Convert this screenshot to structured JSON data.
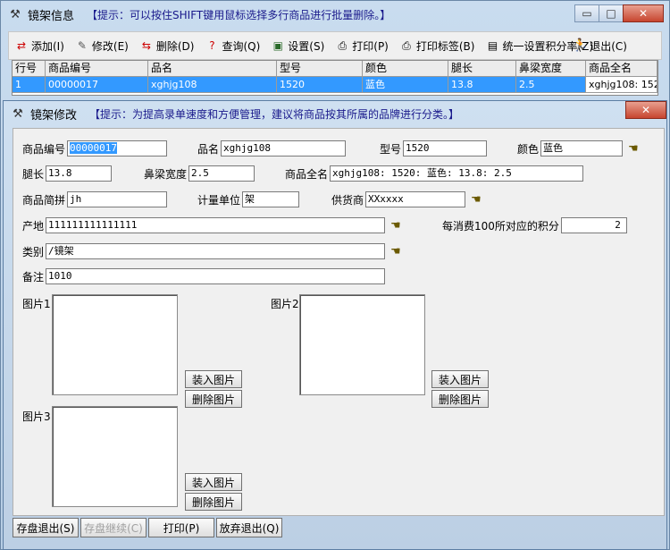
{
  "main_window": {
    "title": "镜架信息",
    "hint": "【提示：可以按住SHIFT键用鼠标选择多行商品进行批量删除。】",
    "controls": {
      "minimize": "▭",
      "maximize": "□",
      "close": "✕"
    }
  },
  "toolbar": {
    "add": "添加(I)",
    "edit": "修改(E)",
    "delete": "删除(D)",
    "query": "查询(Q)",
    "settings": "设置(S)",
    "print": "打印(P)",
    "print_label": "打印标签(B)",
    "set_points_rate": "统一设置积分率(Z)",
    "exit": "退出(C)"
  },
  "grid": {
    "headers": [
      "行号",
      "商品编号",
      "品名",
      "型号",
      "颜色",
      "腿长",
      "鼻梁宽度",
      "商品全名"
    ],
    "rows": [
      [
        "1",
        "00000017",
        "xghjg108",
        "1520",
        "蓝色",
        "13.8",
        "2.5",
        "xghjg108: 152"
      ]
    ]
  },
  "modal": {
    "title": "镜架修改",
    "hint": "【提示：为提高录单速度和方便管理，建议将商品按其所属的品牌进行分类。】",
    "close": "✕",
    "fields": {
      "code_label": "商品编号",
      "code": "00000017",
      "name_label": "品名",
      "name": "xghjg108",
      "model_label": "型号",
      "model": "1520",
      "color_label": "颜色",
      "color": "蓝色",
      "leg_label": "腿长",
      "leg": "13.8",
      "bridge_label": "鼻梁宽度",
      "bridge": "2.5",
      "fullname_label": "商品全名",
      "fullname": "xghjg108: 1520: 蓝色: 13.8: 2.5",
      "pinyin_label": "商品简拼",
      "pinyin": "jh",
      "unit_label": "计量单位",
      "unit": "架",
      "supplier_label": "供货商",
      "supplier": "XXxxxx",
      "origin_label": "产地",
      "origin": "111111111111111",
      "points_label": "每消费100所对应的积分",
      "points": "2",
      "category_label": "类别",
      "category": "/镜架",
      "remark_label": "备注",
      "remark": "1010"
    },
    "pictures": {
      "pic1_label": "图片1",
      "pic2_label": "图片2",
      "pic3_label": "图片3",
      "load": "装入图片",
      "remove": "删除图片"
    },
    "footer": {
      "save_exit": "存盘退出(S)",
      "save_continue": "存盘继续(C)",
      "print": "打印(P)",
      "discard_exit": "放弃退出(Q)"
    }
  }
}
